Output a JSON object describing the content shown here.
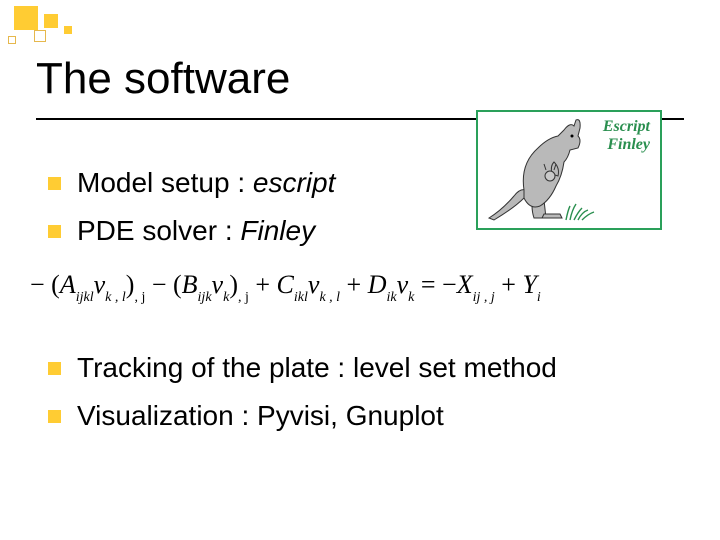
{
  "title": "The software",
  "kangaroo": {
    "label1": "Escript",
    "label2": "Finley"
  },
  "bullets_top": [
    {
      "text": "Model setup : ",
      "em": "escript"
    },
    {
      "text": "PDE solver : ",
      "em": "Finley"
    }
  ],
  "bullets_bottom": [
    {
      "text": "Tracking of the plate : level set method",
      "em": ""
    },
    {
      "text": "Visualization : Pyvisi, Gnuplot",
      "em": ""
    }
  ],
  "equation": {
    "t1": "− (",
    "A": "A",
    "A_sub": "ijkl",
    "v1": "v",
    "v1_sub": "k , l",
    "t2": ")",
    "t2_sub": ", j",
    "t3": " − (",
    "B": "B",
    "B_sub": "ijk",
    "v2": "v",
    "v2_sub": "k",
    "t4": ")",
    "t4_sub": ", j",
    "t5": " + ",
    "C": "C",
    "C_sub": "ikl",
    "v3": "v",
    "v3_sub": "k , l",
    "t6": " + ",
    "D": "D",
    "D_sub": "ik",
    "v4": "v",
    "v4_sub": "k",
    "t7": " = −",
    "X": "X",
    "X_sub": "ij , j",
    "t8": " + ",
    "Y": "Y",
    "Y_sub": "i"
  }
}
